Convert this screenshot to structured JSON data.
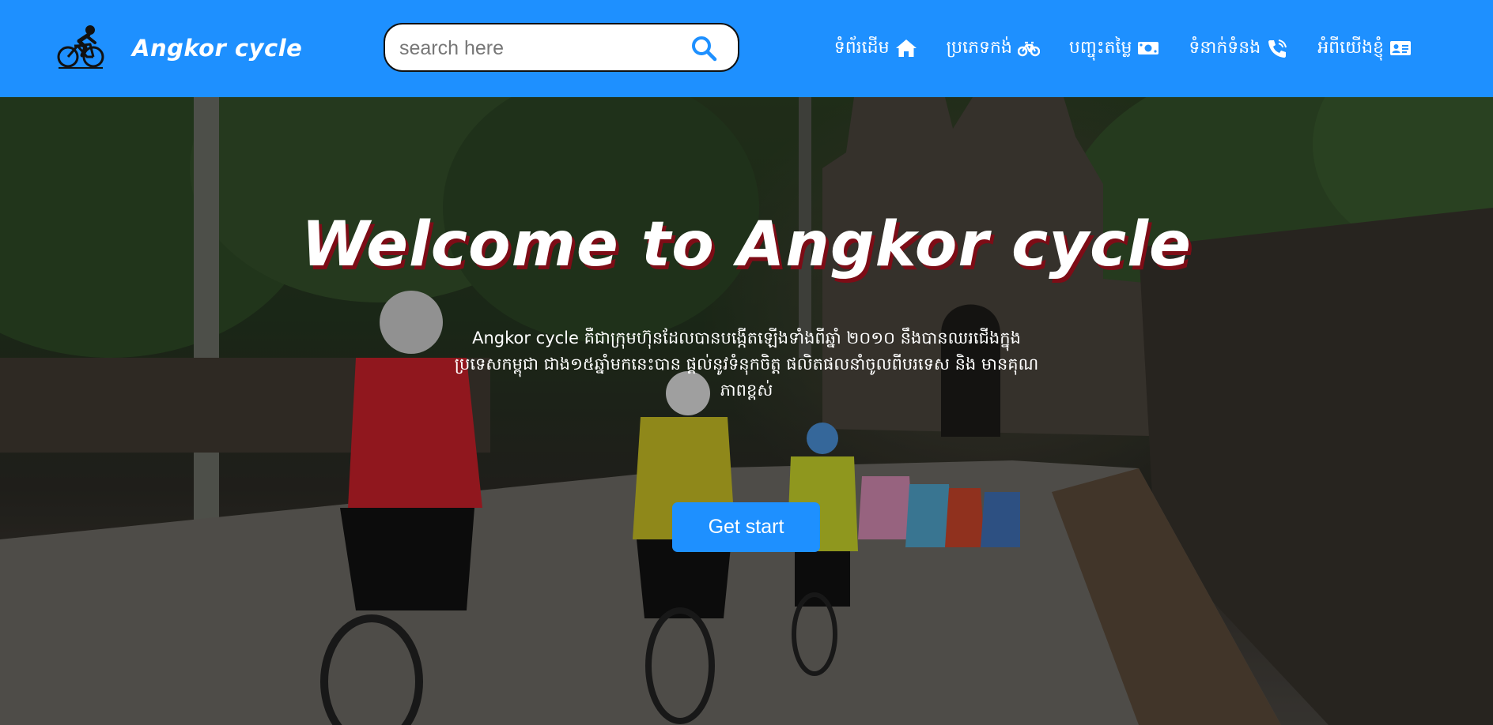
{
  "header": {
    "brand": "Angkor cycle",
    "logo_icon": "cyclist-icon",
    "search": {
      "placeholder": "search here",
      "value": "",
      "icon": "search-icon"
    },
    "nav": [
      {
        "label": "ទំព័រដើម",
        "icon": "home-icon"
      },
      {
        "label": "ប្រភេទកង់",
        "icon": "bicycle-icon"
      },
      {
        "label": "បញ្ចុះតម្លៃ",
        "icon": "money-bill-icon"
      },
      {
        "label": "ទំនាក់ទំនង",
        "icon": "phone-icon"
      },
      {
        "label": "អំពីយើងខ្ញុំ",
        "icon": "id-card-icon"
      }
    ]
  },
  "hero": {
    "title": "Welcome to Angkor cycle",
    "description": "Angkor cycle គឺជាក្រុមហ៊ុនដែលបានបង្កើតឡើងទាំងពីឆ្នាំ ២០១០ នឹងបានឈរជើងក្នុងប្រទេសកម្ពុជា ជាង១៥ឆ្នាំមកនេះបាន ផ្តល់នូវទំនុកចិត្ត ផលិតផលនាំចូលពីបរទេស និង មានគុណភាពខ្ពស់",
    "cta_label": "Get start",
    "background": "cyclists-riding-toward-angkor-temple-gate"
  },
  "colors": {
    "header_bg": "#1e90ff",
    "button_bg": "#1e90ff",
    "title_shadow": "#7d0c16",
    "text": "#ffffff"
  }
}
